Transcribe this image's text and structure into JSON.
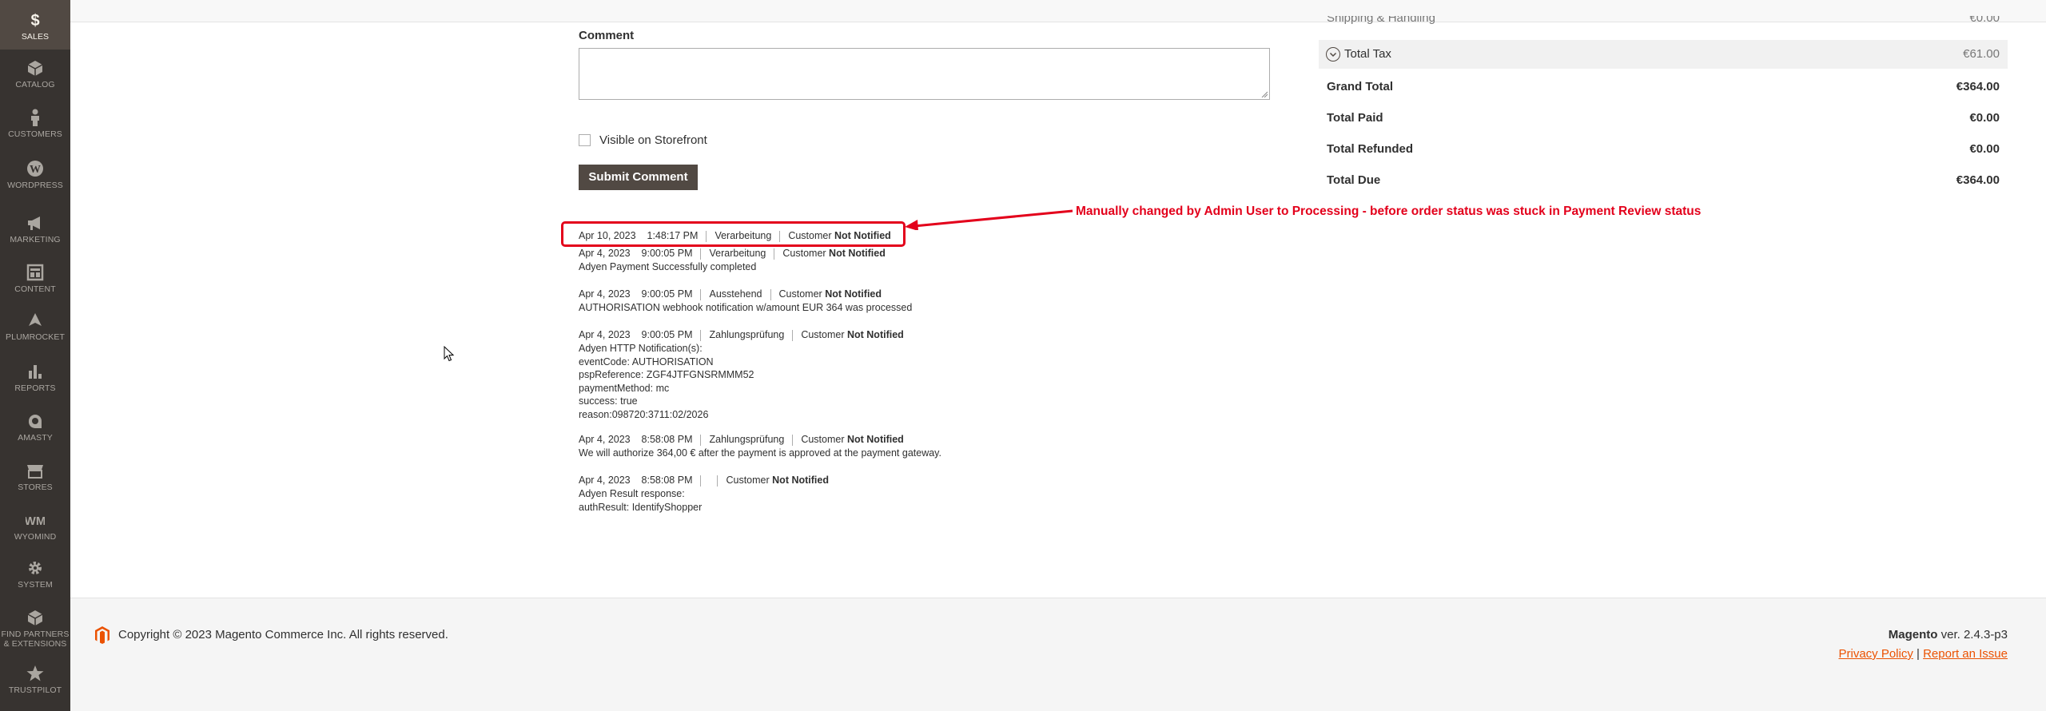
{
  "sidebar": {
    "items": [
      {
        "label": "Sales",
        "icon": "dollar-icon"
      },
      {
        "label": "Catalog",
        "icon": "cube-icon"
      },
      {
        "label": "Customers",
        "icon": "person-icon"
      },
      {
        "label": "WordPress",
        "icon": "wordpress-icon"
      },
      {
        "label": "Marketing",
        "icon": "megaphone-icon"
      },
      {
        "label": "Content",
        "icon": "layout-icon"
      },
      {
        "label": "Plumrocket",
        "icon": "plumrocket-icon"
      },
      {
        "label": "Reports",
        "icon": "bar-chart-icon"
      },
      {
        "label": "Amasty",
        "icon": "amasty-icon"
      },
      {
        "label": "Stores",
        "icon": "store-icon"
      },
      {
        "label": "Wyomind",
        "icon": "wyomind-icon"
      },
      {
        "label": "System",
        "icon": "gear-icon"
      },
      {
        "label": "Find Partners",
        "label2": "& Extensions",
        "icon": "partners-icon"
      },
      {
        "label": "Trustpilot",
        "icon": "star-icon"
      }
    ]
  },
  "comment": {
    "label": "Comment",
    "value": "",
    "visible_label": "Visible on Storefront",
    "submit_label": "Submit Comment"
  },
  "totals": {
    "shipping_label": "Shipping & Handling",
    "shipping_value": "€0.00",
    "tax_label": "Total Tax",
    "tax_value": "€61.00",
    "grand_label": "Grand Total",
    "grand_value": "€364.00",
    "paid_label": "Total Paid",
    "paid_value": "€0.00",
    "refunded_label": "Total Refunded",
    "refunded_value": "€0.00",
    "due_label": "Total Due",
    "due_value": "€364.00"
  },
  "history": [
    {
      "date": "Apr 10, 2023",
      "time": "1:48:17 PM",
      "status": "Verarbeitung",
      "customer": "Customer",
      "notified": "Not Notified",
      "note": []
    },
    {
      "date": "Apr 4, 2023",
      "time": "9:00:05 PM",
      "status": "Verarbeitung",
      "customer": "Customer",
      "notified": "Not Notified",
      "note": [
        "Adyen Payment Successfully completed"
      ]
    },
    {
      "date": "Apr 4, 2023",
      "time": "9:00:05 PM",
      "status": "Ausstehend",
      "customer": "Customer",
      "notified": "Not Notified",
      "note": [
        "AUTHORISATION webhook notification w/amount EUR 364 was processed"
      ]
    },
    {
      "date": "Apr 4, 2023",
      "time": "9:00:05 PM",
      "status": "Zahlungsprüfung",
      "customer": "Customer",
      "notified": "Not Notified",
      "note": [
        "Adyen HTTP Notification(s):",
        "eventCode: AUTHORISATION",
        "pspReference: ZGF4JTFGNSRMMM52",
        "paymentMethod: mc",
        "success: true",
        "reason:098720:3711:02/2026"
      ]
    },
    {
      "date": "Apr 4, 2023",
      "time": "8:58:08 PM",
      "status": "Zahlungsprüfung",
      "customer": "Customer",
      "notified": "Not Notified",
      "note": [
        "We will authorize 364,00 € after the payment is approved at the payment gateway."
      ]
    },
    {
      "date": "Apr 4, 2023",
      "time": "8:58:08 PM",
      "status": "",
      "customer": "Customer",
      "notified": "Not Notified",
      "note": [
        "Adyen Result response:",
        "authResult: IdentifyShopper"
      ]
    }
  ],
  "annotation": "Manually changed by Admin User to Processing - before order status was stuck in Payment Review status",
  "footer": {
    "copyright": "Copyright © 2023 Magento Commerce Inc. All rights reserved.",
    "brand": "Magento",
    "version": "ver. 2.4.3-p3",
    "privacy": "Privacy Policy",
    "sep": "|",
    "report": "Report an Issue"
  },
  "colors": {
    "sidebar_bg": "#373330",
    "sidebar_active": "#514943",
    "annotation_red": "#e3001b",
    "link_orange": "#eb5202",
    "button_bg": "#514943"
  }
}
